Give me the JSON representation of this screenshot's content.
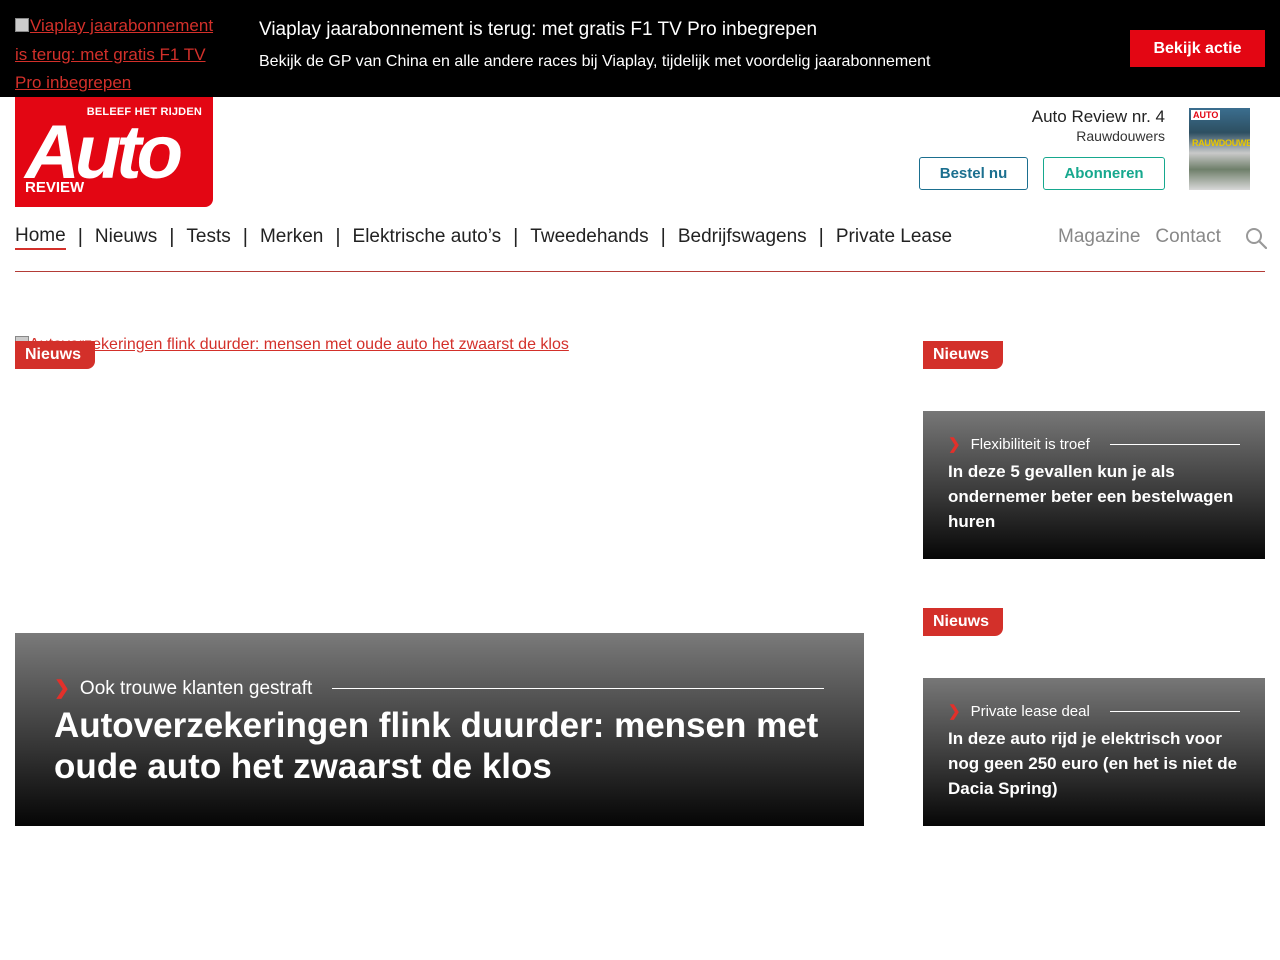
{
  "promo": {
    "image_alt": "Viaplay jaarabonnement is terug: met gratis F1 TV Pro inbegrepen",
    "title": "Viaplay jaarabonnement is terug: met gratis F1 TV Pro inbegrepen",
    "subtitle": "Bekijk de GP van China en alle andere races bij Viaplay, tijdelijk met voordelig jaarabonnement",
    "cta_label": "Bekijk actie",
    "cta_color": "#e30613"
  },
  "logo": {
    "tagline": "BELEEF HET RIJDEN",
    "word": "Auto",
    "sub": "REVIEW",
    "color": "#e30613"
  },
  "magazine": {
    "title": "Auto Review nr. 4",
    "subtitle": "Rauwdouwers",
    "order_label": "Bestel nu",
    "subscribe_label": "Abonneren",
    "cover_logo": "AUTO",
    "cover_headline": "RAUWDOUWERS"
  },
  "nav": {
    "items": [
      "Home",
      "Nieuws",
      "Tests",
      "Merken",
      "Elektrische auto’s",
      "Tweedehands",
      "Bedrijfswagens",
      "Private Lease"
    ],
    "active": "Home",
    "secondary": [
      "Magazine",
      "Contact"
    ],
    "search_icon": "search-icon"
  },
  "hero": {
    "image_alt": "Autoverzekeringen flink duurder: mensen met oude auto het zwaarst de klos",
    "badge": "Nieuws",
    "kicker": "Ook trouwe klanten gestraft",
    "title": "Autoverzekeringen flink duurder: mensen met oude auto het zwaarst de klos"
  },
  "side": [
    {
      "badge": "Nieuws",
      "kicker": "Flexibiliteit is troef",
      "title": "In deze 5 gevallen kun je als ondernemer beter een bestelwagen huren"
    },
    {
      "badge": "Nieuws",
      "kicker": "Private lease deal",
      "title": "In deze auto rijd je elektrisch voor nog geen 250 euro (en het is niet de Dacia Spring)"
    }
  ],
  "colors": {
    "accent": "#d3302a",
    "order_button": "#1b6f8f",
    "subscribe_button": "#16a88e"
  }
}
